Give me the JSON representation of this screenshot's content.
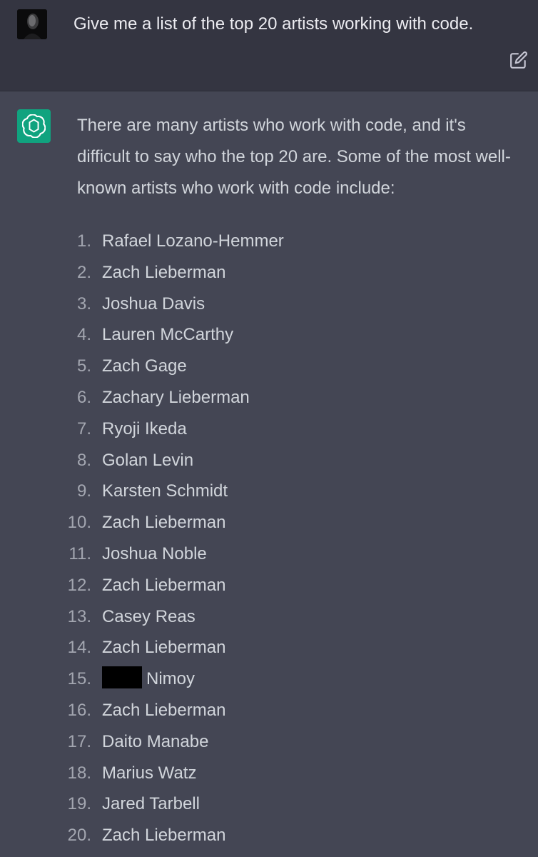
{
  "user_message": {
    "text": "Give me a list of the top 20 artists working with code."
  },
  "assistant_message": {
    "intro": "There are many artists who work with code, and it's difficult to say who the top 20 are. Some of the most well-known artists who work with code include:",
    "artists": [
      {
        "num": "1.",
        "name": "Rafael Lozano-Hemmer"
      },
      {
        "num": "2.",
        "name": "Zach Lieberman"
      },
      {
        "num": "3.",
        "name": "Joshua Davis"
      },
      {
        "num": "4.",
        "name": "Lauren McCarthy"
      },
      {
        "num": "5.",
        "name": "Zach Gage"
      },
      {
        "num": "6.",
        "name": "Zachary Lieberman"
      },
      {
        "num": "7.",
        "name": "Ryoji Ikeda"
      },
      {
        "num": "8.",
        "name": "Golan Levin"
      },
      {
        "num": "9.",
        "name": "Karsten Schmidt"
      },
      {
        "num": "10.",
        "name": "Zach Lieberman"
      },
      {
        "num": "11.",
        "name": "Joshua Noble"
      },
      {
        "num": "12.",
        "name": "Zach Lieberman"
      },
      {
        "num": "13.",
        "name": "Casey Reas"
      },
      {
        "num": "14.",
        "name": "Zach Lieberman"
      },
      {
        "num": "15.",
        "name": "Nimoy",
        "redacted": true
      },
      {
        "num": "16.",
        "name": "Zach Lieberman"
      },
      {
        "num": "17.",
        "name": "Daito Manabe"
      },
      {
        "num": "18.",
        "name": "Marius Watz"
      },
      {
        "num": "19.",
        "name": "Jared Tarbell"
      },
      {
        "num": "20.",
        "name": "Zach Lieberman"
      }
    ]
  },
  "icons": {
    "user_avatar": "user-avatar",
    "edit": "edit-icon",
    "assistant_logo": "openai-logo-icon"
  },
  "colors": {
    "user_bg": "#343541",
    "assistant_bg": "#444654",
    "logo_bg": "#10a37f",
    "text": "#d1d5db"
  }
}
